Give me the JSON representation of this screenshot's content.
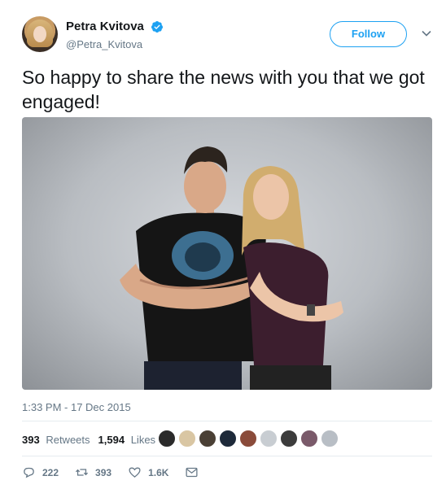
{
  "author": {
    "display_name": "Petra Kvitova",
    "handle": "@Petra_Kvitova",
    "verified": true
  },
  "follow_label": "Follow",
  "tweet": {
    "text": "So happy to share the news with you that we got engaged!",
    "timestamp": "1:33 PM - 17 Dec 2015"
  },
  "stats": {
    "retweets_count": "393",
    "retweets_label": "Retweets",
    "likes_count": "1,594",
    "likes_label": "Likes"
  },
  "liker_avatar_colors": [
    "#2b2b2b",
    "#d9c6a3",
    "#4a4035",
    "#1e2a3a",
    "#8a4b3a",
    "#c8cdd2",
    "#3c3c3c",
    "#7a5a6a",
    "#b8bec5"
  ],
  "actions": {
    "replies": "222",
    "retweets": "393",
    "likes": "1.6K"
  },
  "colors": {
    "accent": "#1da1f2",
    "secondary_text": "#657786"
  }
}
